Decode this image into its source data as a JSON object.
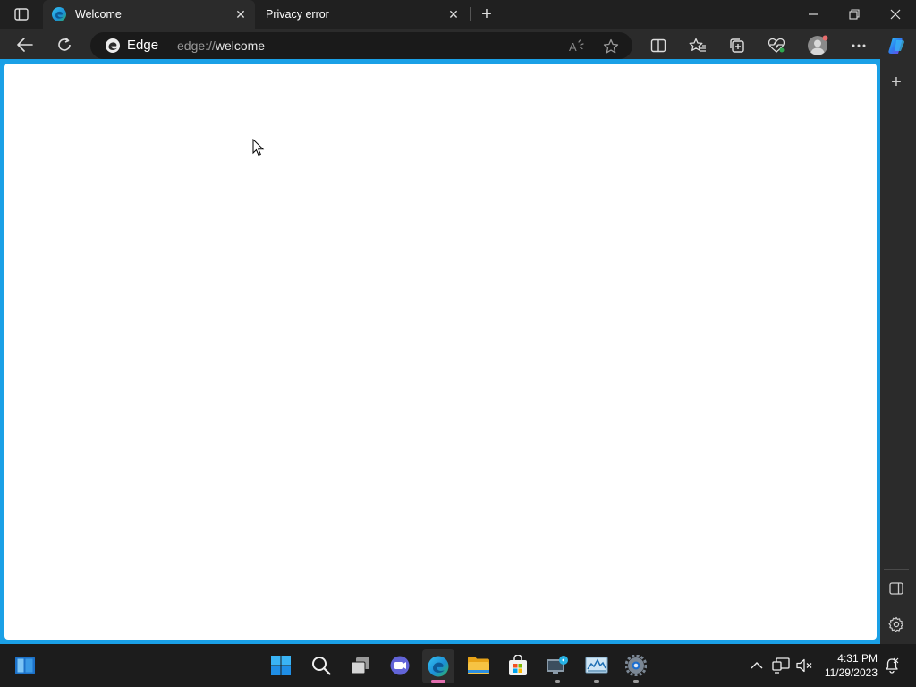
{
  "browser": {
    "tabs": [
      {
        "title": "Welcome",
        "active": true,
        "icon": "edge-icon"
      },
      {
        "title": "Privacy error",
        "active": false
      }
    ],
    "new_tab_symbol": "+",
    "address": {
      "badge_label": "Edge",
      "url_scheme": "edge://",
      "url_path": "welcome"
    },
    "accent_color": "#1aa0e6"
  },
  "sidebar": {
    "add_symbol": "+"
  },
  "taskbar": {
    "clock": {
      "time": "4:31 PM",
      "date": "11/29/2023"
    },
    "pinned_apps": [
      "start",
      "search",
      "task-view",
      "teams",
      "edge",
      "file-explorer",
      "microsoft-store",
      "remote-desktop",
      "performance-monitor",
      "settings"
    ]
  }
}
